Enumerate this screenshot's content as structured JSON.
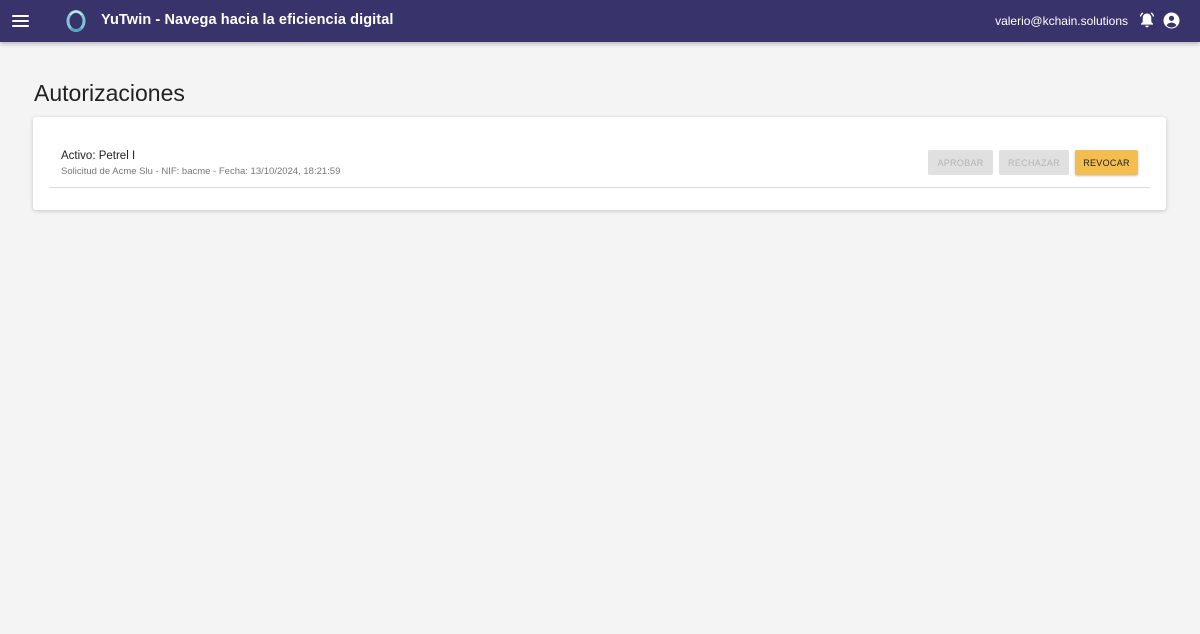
{
  "header": {
    "title": "YuTwin - Navega hacia la eficiencia digital",
    "user_email": "valerio@kchain.solutions",
    "icons": [
      "menu-icon",
      "app-logo",
      "notifications-icon",
      "account-circle-icon"
    ],
    "colors": {
      "bar": "#38336b",
      "text": "#ffffff"
    }
  },
  "page": {
    "title": "Autorizaciones"
  },
  "authorizations": [
    {
      "title": "Activo: Petrel I",
      "subtitle": "Solicitud de Acme Slu - NIF: bacme - Fecha: 13/10/2024, 18:21:59",
      "actions": {
        "approve": {
          "label": "APROBAR",
          "enabled": false
        },
        "reject": {
          "label": "RECHAZAR",
          "enabled": false
        },
        "revoke": {
          "label": "REVOCAR",
          "enabled": true,
          "color": "#f3bd4f"
        }
      }
    }
  ]
}
